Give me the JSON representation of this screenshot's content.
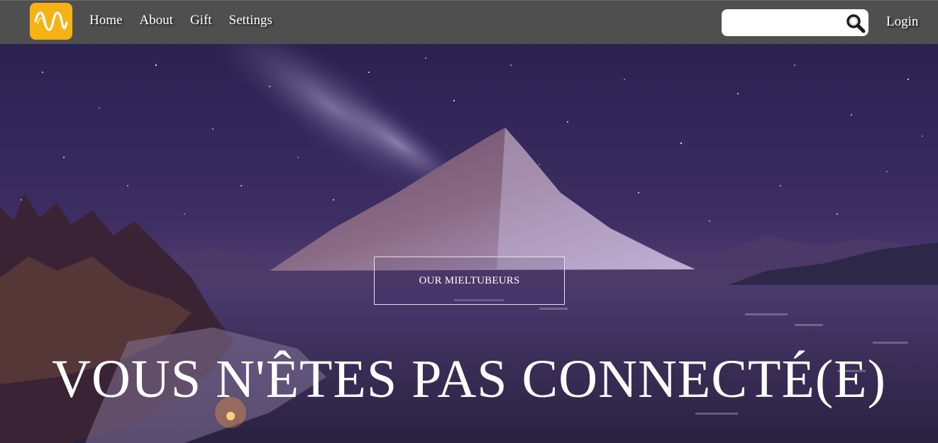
{
  "navbar": {
    "logo_icon": "sine-wave-logo-icon",
    "links": [
      "Home",
      "About",
      "Gift",
      "Settings"
    ],
    "search": {
      "value": "",
      "placeholder": "",
      "icon": "search-icon"
    },
    "login_label": "Login"
  },
  "hero": {
    "cta_label": "OUR MIELTUBEURS",
    "headline": "VOUS N'ÊTES PAS CONNECTÉ(E)"
  },
  "colors": {
    "navbar_bg": "#4f4f4f",
    "logo_bg": "#f6b113",
    "sky_top": "#2b2150",
    "text": "#ffffff"
  }
}
